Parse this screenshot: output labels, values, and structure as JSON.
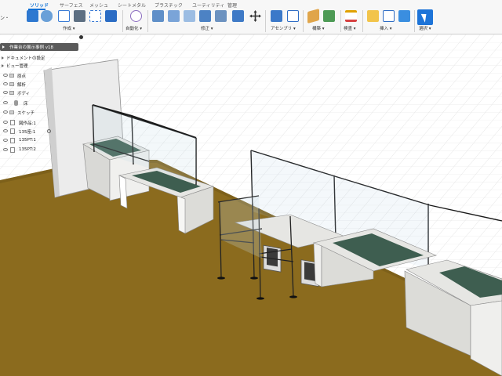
{
  "toolbar": {
    "tabs": [
      "ソリッド",
      "サーフェス",
      "メッシュ",
      "シートメタル",
      "プラスチック",
      "ユーティリティ",
      "管理"
    ],
    "left_cut_label": "ン・",
    "groups": [
      "作成 ▾",
      "自動化 ▾",
      "修正 ▾",
      "アセンブリ ▾",
      "構築 ▾",
      "検査 ▾",
      "挿入 ▾",
      "選択 ▾"
    ]
  },
  "browser": {
    "title": "作業台の展示事例 v18",
    "items": [
      {
        "label": "ドキュメントの設定"
      },
      {
        "label": "ビュー管理"
      },
      {
        "label": "原点"
      },
      {
        "label": "解析"
      },
      {
        "label": "ボディ"
      },
      {
        "label": "床"
      },
      {
        "label": "スケッチ"
      },
      {
        "label": "図作品:1"
      },
      {
        "label": "135座:1"
      },
      {
        "label": "135PT:1"
      },
      {
        "label": "135PT:2"
      }
    ]
  },
  "colors": {
    "accent": "#0a6fd6",
    "select_button": "#1d74d8",
    "floor": "#8b6b1e",
    "grid": "#d9d9d9",
    "mat": "#3e5e50",
    "desk": "#e6e6e3",
    "browser_header": "#5a5a5a"
  },
  "icons": [
    "new-component-icon",
    "extrude-icon",
    "sketch-icon",
    "automate-icon",
    "press-pull-icon",
    "move-icon",
    "joint-icon",
    "plane-icon",
    "measure-icon",
    "insert-icon",
    "image-icon",
    "select-icon"
  ]
}
